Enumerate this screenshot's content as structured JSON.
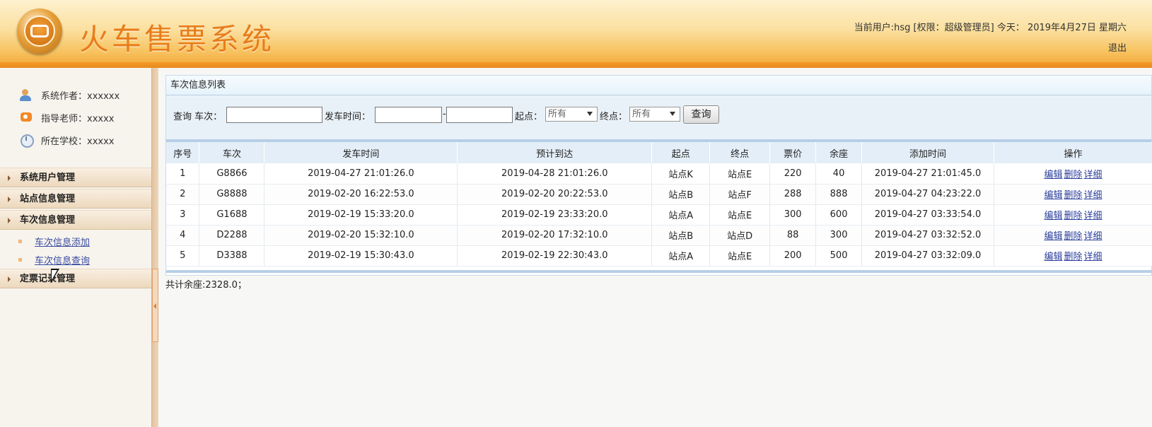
{
  "header": {
    "title": "火车售票系统",
    "user_info": "当前用户:hsg [权限：超级管理员] 今天： 2019年4月27日 星期六",
    "logout_label": "退出"
  },
  "sidebar": {
    "info": [
      {
        "icon": "author-icon",
        "text": "系统作者：xxxxxx"
      },
      {
        "icon": "teacher-icon",
        "text": "指导老师：xxxxx"
      },
      {
        "icon": "school-icon",
        "text": "所在学校：xxxxx"
      }
    ],
    "menus": [
      {
        "label": "系统用户管理"
      },
      {
        "label": "站点信息管理"
      },
      {
        "label": "车次信息管理",
        "items": [
          "车次信息添加",
          "车次信息查询"
        ]
      },
      {
        "label": "定票记录管理"
      }
    ]
  },
  "panel": {
    "title": "车次信息列表",
    "search": {
      "query_label": "查询 车次：",
      "train_value": "",
      "depart_label": "发车时间：",
      "depart_from": "",
      "depart_sep": "-",
      "depart_to": "",
      "start_label": "起点：",
      "start_value": "所有",
      "end_label": "终点：",
      "end_value": "所有",
      "button_label": "查询"
    },
    "columns": [
      "序号",
      "车次",
      "发车时间",
      "预计到达",
      "起点",
      "终点",
      "票价",
      "余座",
      "添加时间",
      "操作"
    ],
    "rows": [
      [
        "1",
        "G8866",
        "2019-04-27 21:01:26.0",
        "2019-04-28 21:01:26.0",
        "站点K",
        "站点E",
        "220",
        "40",
        "2019-04-27 21:01:45.0"
      ],
      [
        "2",
        "G8888",
        "2019-02-20 16:22:53.0",
        "2019-02-20 20:22:53.0",
        "站点B",
        "站点F",
        "288",
        "888",
        "2019-04-27 04:23:22.0"
      ],
      [
        "3",
        "G1688",
        "2019-02-19 15:33:20.0",
        "2019-02-19 23:33:20.0",
        "站点A",
        "站点E",
        "300",
        "600",
        "2019-04-27 03:33:54.0"
      ],
      [
        "4",
        "D2288",
        "2019-02-20 15:32:10.0",
        "2019-02-20 17:32:10.0",
        "站点B",
        "站点D",
        "88",
        "300",
        "2019-04-27 03:32:52.0"
      ],
      [
        "5",
        "D3388",
        "2019-02-19 15:30:43.0",
        "2019-02-19 22:30:43.0",
        "站点A",
        "站点E",
        "200",
        "500",
        "2019-04-27 03:32:09.0"
      ]
    ],
    "ops": [
      "编辑",
      "删除",
      "详细"
    ],
    "total_text": "共计余座:2328.0；"
  }
}
